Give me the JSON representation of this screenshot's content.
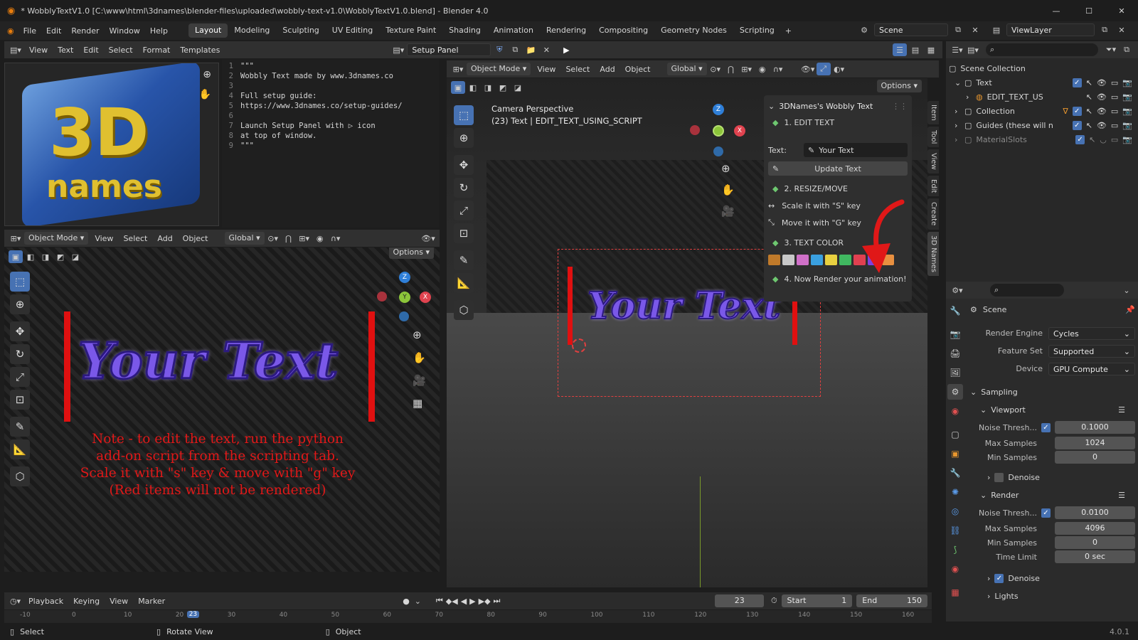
{
  "titlebar": {
    "title": "* WobblyTextV1.0 [C:\\www\\html\\3dnames\\blender-files\\uploaded\\wobbly-text-v1.0\\WobblyTextV1.0.blend] - Blender 4.0"
  },
  "menu": [
    "File",
    "Edit",
    "Render",
    "Window",
    "Help"
  ],
  "workspaces": [
    "Layout",
    "Modeling",
    "Sculpting",
    "UV Editing",
    "Texture Paint",
    "Shading",
    "Animation",
    "Rendering",
    "Compositing",
    "Geometry Nodes",
    "Scripting"
  ],
  "scene": {
    "name": "Scene",
    "viewlayer": "ViewLayer"
  },
  "texteditor": {
    "menus": [
      "View",
      "Text",
      "Edit",
      "Select",
      "Format",
      "Templates"
    ],
    "textname": "Setup Panel",
    "lines": [
      {
        "n": "1",
        "t": "\"\"\""
      },
      {
        "n": "2",
        "t": "Wobbly Text made by www.3dnames.co"
      },
      {
        "n": "3",
        "t": ""
      },
      {
        "n": "4",
        "t": "Full setup guide:"
      },
      {
        "n": "5",
        "t": "https://www.3dnames.co/setup-guides/"
      },
      {
        "n": "6",
        "t": ""
      },
      {
        "n": "7",
        "t": "Launch Setup Panel with ▷ icon"
      },
      {
        "n": "8",
        "t": "at top of window."
      },
      {
        "n": "9",
        "t": "\"\"\""
      }
    ]
  },
  "logo": {
    "line1": "3D",
    "line2": "names"
  },
  "viewport_left": {
    "mode": "Object Mode",
    "menus": [
      "View",
      "Select",
      "Add",
      "Object"
    ],
    "orientation": "Global",
    "options": "Options",
    "text3d": "Your Text",
    "note": [
      "Note - to edit the text, run the python",
      "add-on script from the scripting tab.",
      "Scale it with \"s\" key & move with \"g\" key",
      "(Red items will not be rendered)"
    ]
  },
  "viewport_main": {
    "mode": "Object Mode",
    "menus": [
      "View",
      "Select",
      "Add",
      "Object"
    ],
    "orientation": "Global",
    "options": "Options",
    "camera_title": "Camera Perspective",
    "camera_sub": "(23) Text | EDIT_TEXT_USING_SCRIPT",
    "text3d": "Your Text"
  },
  "wobbly_panel": {
    "title": "3DNames's Wobbly Text",
    "step1": "1. EDIT TEXT",
    "text_label": "Text:",
    "text_value": "Your Text",
    "update_button": "Update Text",
    "step2": "2. RESIZE/MOVE",
    "scale_hint": "Scale it with \"S\" key",
    "move_hint": "Move it with \"G\" key",
    "step3": "3. TEXT COLOR",
    "step4": "4. Now Render your animation!",
    "swatches": [
      "#c07a2a",
      "#c8c8c8",
      "#d070c8",
      "#3aa0e0",
      "#e8d040",
      "#40b860",
      "#e04050",
      "#8040e0",
      "#e89040"
    ]
  },
  "sidebar_tabs": [
    "Item",
    "Tool",
    "View",
    "Edit",
    "Create",
    "3D Names"
  ],
  "outliner": {
    "root": "Scene Collection",
    "items": [
      {
        "name": "Text",
        "indent": 1
      },
      {
        "name": "EDIT_TEXT_US",
        "indent": 2
      },
      {
        "name": "Collection",
        "indent": 1
      },
      {
        "name": "Guides (these will n",
        "indent": 1
      },
      {
        "name": "MaterialSlots",
        "indent": 1
      }
    ]
  },
  "properties": {
    "context": "Scene",
    "render_engine_label": "Render Engine",
    "render_engine": "Cycles",
    "feature_set_label": "Feature Set",
    "feature_set": "Supported",
    "device_label": "Device",
    "device": "GPU Compute",
    "sampling": "Sampling",
    "viewport": "Viewport",
    "noise_label": "Noise Thresh...",
    "vp_noise": "0.1000",
    "max_samples_label": "Max Samples",
    "vp_max": "1024",
    "min_samples_label": "Min Samples",
    "vp_min": "0",
    "denoise": "Denoise",
    "render": "Render",
    "r_noise": "0.0100",
    "r_max": "4096",
    "r_min": "0",
    "time_limit_label": "Time Limit",
    "r_time": "0 sec",
    "lights": "Lights"
  },
  "timeline": {
    "menus": [
      "Playback",
      "Keying",
      "View",
      "Marker"
    ],
    "frame": "23",
    "start_label": "Start",
    "start": "1",
    "end_label": "End",
    "end": "150",
    "ticks": [
      "-10",
      "0",
      "10",
      "20",
      "30",
      "40",
      "50",
      "60",
      "70",
      "80",
      "90",
      "100",
      "110",
      "120",
      "130",
      "140",
      "150",
      "160"
    ],
    "current": "23"
  },
  "statusbar": {
    "select": "Select",
    "rotate": "Rotate View",
    "object": "Object",
    "version": "4.0.1"
  }
}
